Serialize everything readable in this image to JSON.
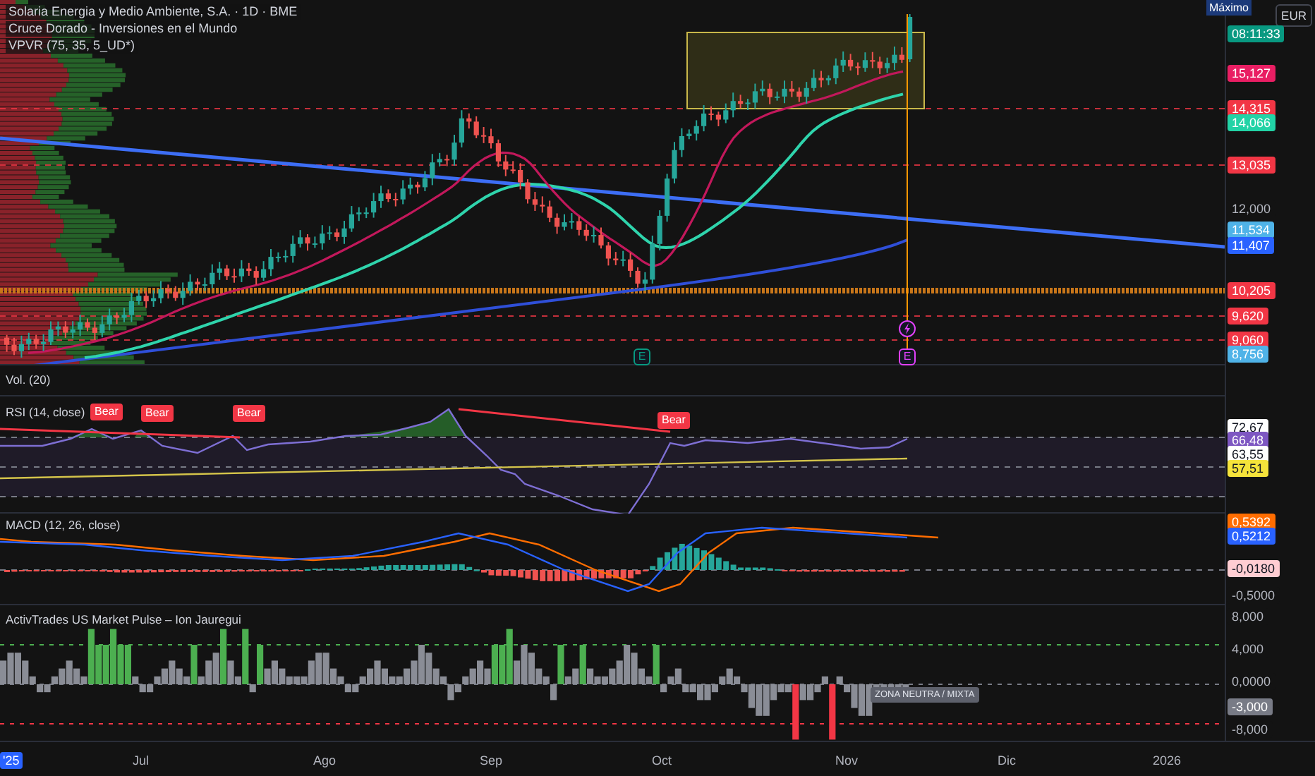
{
  "main_pane": {
    "symbol": "Solaria Energia y Medio Ambiente, S.A. · 1D · BME",
    "indicators": [
      "Cruce Dorado - Inversiones en el Mundo",
      "VPVR (75, 35, 5_UD*)"
    ],
    "high_tag": "Máximo",
    "currency": "EUR",
    "price_labels": [
      {
        "text": "08:11:33",
        "color": "#089981"
      },
      {
        "text": "15,127",
        "color": "#e91e63"
      },
      {
        "text": "14,315",
        "color": "#f23645"
      },
      {
        "text": "14,066",
        "color": "#22d3a6"
      },
      {
        "text": "13,035",
        "color": "#f23645"
      },
      {
        "text": "12,000"
      },
      {
        "text": "11,534",
        "color": "#4fb3e8"
      },
      {
        "text": "11,407",
        "color": "#2962ff"
      },
      {
        "text": "10,205",
        "color": "#f23645"
      },
      {
        "text": "9,620",
        "color": "#f23645"
      },
      {
        "text": "9,060",
        "color": "#f23645"
      },
      {
        "text": "8,756",
        "color": "#4fb3e8"
      }
    ],
    "markers": [
      {
        "kind": "letter",
        "label": "E",
        "color": "#089981"
      },
      {
        "kind": "bolt",
        "color": "#e040fb"
      },
      {
        "kind": "letter",
        "label": "E",
        "color": "#e040fb"
      }
    ]
  },
  "volume_pane": {
    "title": "Vol. (20)"
  },
  "rsi_pane": {
    "title": "RSI (14, close)",
    "signals": [
      "Bear",
      "Bear",
      "Bear",
      "Bear"
    ],
    "axis_labels": [
      {
        "text": "72,67",
        "color": "#ffffff"
      },
      {
        "text": "66,48",
        "color": "#7e57c2"
      },
      {
        "text": "63,55",
        "color": "#ffffff"
      },
      {
        "text": "57,51",
        "color": "#f5e33b"
      }
    ]
  },
  "macd_pane": {
    "title": "MACD (12, 26, close)",
    "axis_labels": [
      {
        "text": "0,5392",
        "color": "#ff6d00"
      },
      {
        "text": "0,5212",
        "color": "#2962ff"
      },
      {
        "text": "-0,0180",
        "color": "#ffcdd2"
      },
      {
        "text": "-0,5000"
      }
    ]
  },
  "pulse_pane": {
    "title": "ActivTrades US Market Pulse – Ion Jauregui",
    "zone_tag": "ZONA NEUTRA / MIXTA",
    "axis_labels": [
      {
        "text": "8,000"
      },
      {
        "text": "4,000"
      },
      {
        "text": "0,0000"
      },
      {
        "text": "-3,000",
        "color": "#787b86"
      },
      {
        "text": "-8,000"
      }
    ]
  },
  "time_axis": [
    {
      "text": "'25",
      "highlighted": true
    },
    {
      "text": "Jul",
      "highlighted": false
    },
    {
      "text": "Ago",
      "highlighted": false
    },
    {
      "text": "Sep",
      "highlighted": false
    },
    {
      "text": "Oct",
      "highlighted": false
    },
    {
      "text": "Nov",
      "highlighted": false
    },
    {
      "text": "Dic",
      "highlighted": false
    },
    {
      "text": "2026",
      "highlighted": false
    }
  ]
}
